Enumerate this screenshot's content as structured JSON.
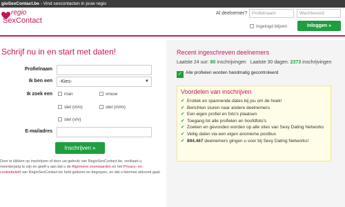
{
  "window": {
    "site": "gioSexContact.be",
    "subtitle": " - Vind sexcontacten in jouw regio"
  },
  "logo": {
    "line1": "regio",
    "line2": "SexContact"
  },
  "login": {
    "label": "Al deelnemer?",
    "user_placeholder": "Profielnaam",
    "pass_placeholder": "Wachtwoord",
    "remember_label": "Ingelogd blijven",
    "button_label": "Inloggen »"
  },
  "signup": {
    "title": "Schrijf nu in en start met daten!",
    "profiel_label": "Profielnaam",
    "ikben_label": "Ik ben een",
    "ikben_value": "-Kies-",
    "ikzoek_label": "Ik zoek een",
    "options": [
      "man",
      "vrouw",
      "stel (m/v)",
      "stel (m/m)",
      "stel (v/v)"
    ],
    "email_label": "E-mailadres",
    "button_label": "Inschrijven »",
    "disclaimer_1": "Door te klikken op inschrijven of door uw gebruik van RegioSexContact.be, verklaart u meerderjarig te zijn en geeft u aan dat u de ",
    "link_voorwaarden": "Algemene voorwaarden",
    "disclaimer_2": " en het ",
    "link_privacy": "Privacy- en cookiebeleid",
    "disclaimer_3": " van RegioSexContact.be hebt gelezen en begrepen, en dat u hiermee akkoord gaat."
  },
  "recent": {
    "title": "Recent ingeschreven deelnemers",
    "stats_pre": "Laatste 24 uur: ",
    "count_24h": "80",
    "stats_mid": " inschrijvingen   Laatste 30 dagen: ",
    "count_30d": "2373",
    "stats_post": " inschrijvingen",
    "verified": "Alle profielen worden handmatig gecontroleerd"
  },
  "benefits": {
    "title": "Voordelen van inschrijven",
    "items": [
      "Erotiek en spannende dates bij jou om de hoek!",
      "Berichten sturen naar andere deelnemers",
      "Een eigen profiel en foto's plaatsen",
      "Toegang tot alle profielen en hoofdfoto's",
      "Zoeken en gevonden worden op alle sites van Sexy Dating Networks",
      "Veilig daten via een eigen anonieme postbus"
    ],
    "last_count": "894.467",
    "last_text": " deelnemers gingen u voor bij Sexy Dating Networks!"
  },
  "colors": {
    "brand": "#c2185b",
    "accent_green": "#1e9e3e"
  }
}
